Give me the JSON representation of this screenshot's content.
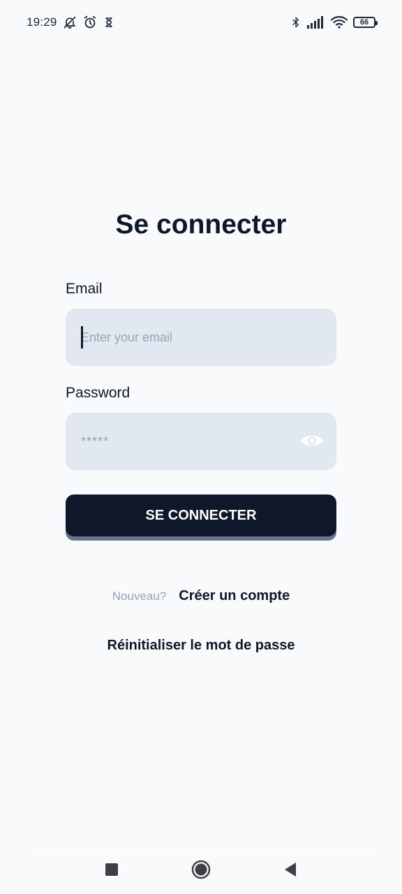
{
  "status_bar": {
    "time": "19:29",
    "battery": "66",
    "icons": [
      "bell-off-icon",
      "alarm-icon",
      "hourglass-icon",
      "bluetooth-icon",
      "signal-icon",
      "wifi-icon",
      "battery-icon"
    ]
  },
  "login": {
    "title": "Se connecter",
    "email_label": "Email",
    "email_placeholder": "Enter your email",
    "email_value": "",
    "password_label": "Password",
    "password_value": "*****",
    "submit_label": "SE CONNECTER",
    "new_prompt": "Nouveau?",
    "create_account": "Créer un compte",
    "reset_password": "Réinitialiser le mot de passe"
  },
  "nav": {
    "icons": [
      "recents-square-icon",
      "home-circle-icon",
      "back-triangle-icon"
    ]
  },
  "colors": {
    "background": "#f8fafc",
    "primary": "#0f172a",
    "input_bg": "#e2e8f0",
    "muted": "#94a3b8"
  }
}
